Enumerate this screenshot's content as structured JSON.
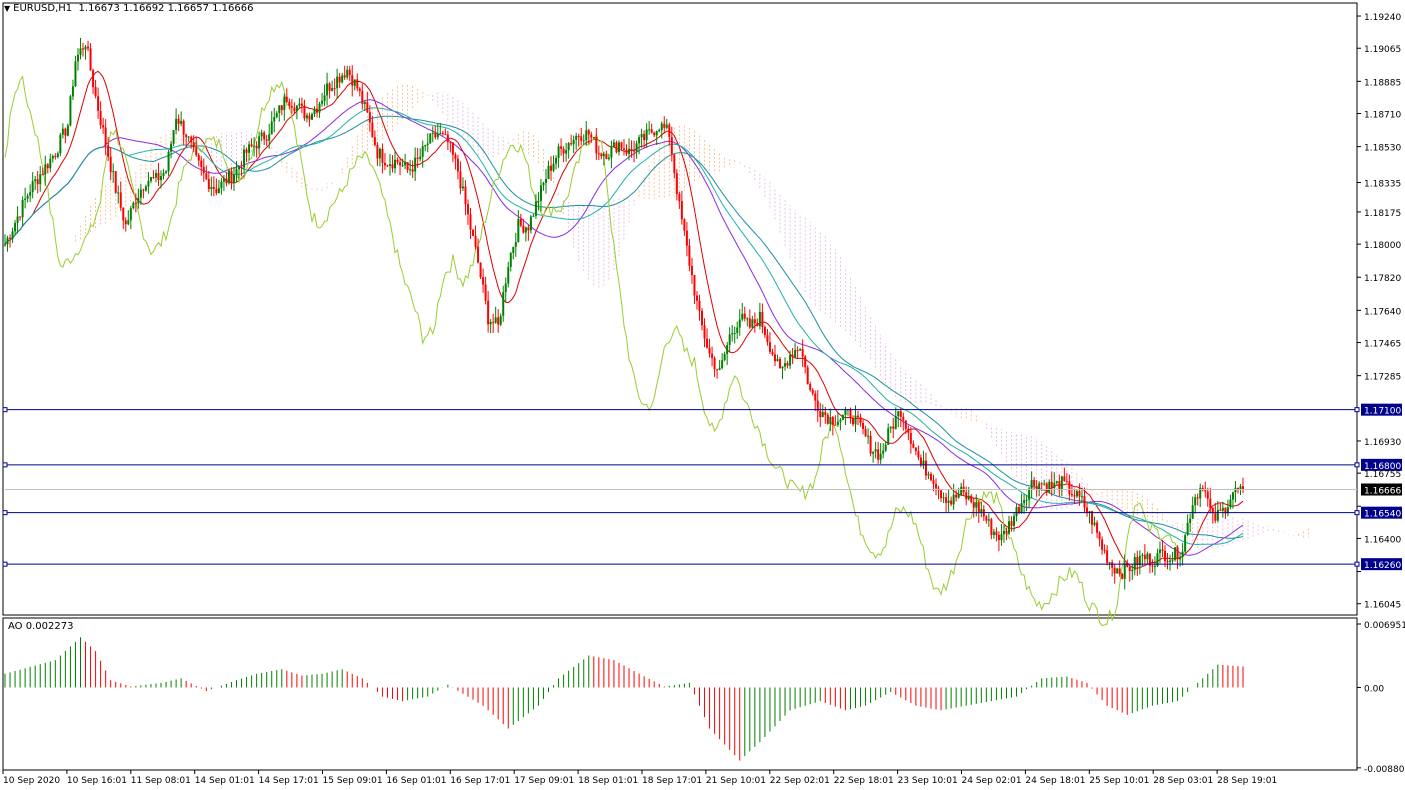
{
  "symbol_header": {
    "menu_icon": "triangle-down-icon",
    "symbol": "EURUSD,H1",
    "ohlc": "1.16673 1.16692 1.16657 1.16666"
  },
  "indicator_header": {
    "name": "AO",
    "value": "0.002273"
  },
  "colors": {
    "bull": "#008000",
    "bear": "#ff0000",
    "ma_red": "#e00000",
    "ma_purple": "#8a2be2",
    "ma_teal": "#20b2aa",
    "ma_blue_green": "#1e90a0",
    "chikou": "#9acd32",
    "kumo_up": "#f4a460",
    "kumo_down": "#dda0dd",
    "hline": "#00008b",
    "price_label_bg": "#00008b",
    "bid_label_bg": "#000000"
  },
  "chart_data": [
    {
      "type": "candlestick",
      "title": "EURUSD,H1",
      "ylim": [
        1.16,
        1.193
      ],
      "y_ticks": [
        "1.19240",
        "1.19065",
        "1.18885",
        "1.18710",
        "1.18530",
        "1.18335",
        "1.18175",
        "1.18000",
        "1.17820",
        "1.17640",
        "1.17465",
        "1.17285",
        "1.16930",
        "1.16755",
        "1.16575",
        "1.16400",
        "1.16220",
        "1.16045"
      ],
      "x_ticks": [
        "10 Sep 2020",
        "10 Sep 16:01",
        "11 Sep 08:01",
        "14 Sep 01:01",
        "14 Sep 17:01",
        "15 Sep 09:01",
        "16 Sep 01:01",
        "16 Sep 17:01",
        "17 Sep 09:01",
        "18 Sep 01:01",
        "18 Sep 17:01",
        "21 Sep 10:01",
        "22 Sep 02:01",
        "22 Sep 18:01",
        "23 Sep 10:01",
        "24 Sep 02:01",
        "24 Sep 18:01",
        "25 Sep 10:01",
        "28 Sep 03:01",
        "28 Sep 19:01"
      ],
      "horizontal_levels": [
        {
          "label": "1.17100",
          "value": 1.171
        },
        {
          "label": "1.16800",
          "value": 1.168
        },
        {
          "label": "1.16540",
          "value": 1.1654
        },
        {
          "label": "1.16260",
          "value": 1.1626
        }
      ],
      "bid": {
        "label": "1.16666",
        "value": 1.16666
      },
      "close_path": [
        [
          0,
          1.18
        ],
        [
          5,
          1.1815
        ],
        [
          10,
          1.183
        ],
        [
          15,
          1.184
        ],
        [
          20,
          1.185
        ],
        [
          25,
          1.1865
        ],
        [
          28,
          1.19
        ],
        [
          32,
          1.191
        ],
        [
          36,
          1.188
        ],
        [
          40,
          1.1855
        ],
        [
          44,
          1.183
        ],
        [
          48,
          1.181
        ],
        [
          52,
          1.1825
        ],
        [
          56,
          1.1835
        ],
        [
          60,
          1.1835
        ],
        [
          64,
          1.184
        ],
        [
          68,
          1.187
        ],
        [
          72,
          1.186
        ],
        [
          76,
          1.1845
        ],
        [
          80,
          1.1835
        ],
        [
          84,
          1.183
        ],
        [
          88,
          1.1835
        ],
        [
          92,
          1.184
        ],
        [
          96,
          1.185
        ],
        [
          100,
          1.1855
        ],
        [
          104,
          1.186
        ],
        [
          108,
          1.187
        ],
        [
          112,
          1.188
        ],
        [
          116,
          1.1875
        ],
        [
          120,
          1.187
        ],
        [
          124,
          1.1875
        ],
        [
          128,
          1.1885
        ],
        [
          132,
          1.189
        ],
        [
          136,
          1.1895
        ],
        [
          140,
          1.1885
        ],
        [
          144,
          1.187
        ],
        [
          148,
          1.185
        ],
        [
          152,
          1.1845
        ],
        [
          156,
          1.1845
        ],
        [
          160,
          1.184
        ],
        [
          164,
          1.1845
        ],
        [
          168,
          1.1855
        ],
        [
          172,
          1.186
        ],
        [
          176,
          1.1855
        ],
        [
          180,
          1.184
        ],
        [
          184,
          1.1815
        ],
        [
          188,
          1.179
        ],
        [
          192,
          1.176
        ],
        [
          196,
          1.1755
        ],
        [
          200,
          1.179
        ],
        [
          204,
          1.181
        ],
        [
          208,
          1.181
        ],
        [
          212,
          1.1825
        ],
        [
          216,
          1.184
        ],
        [
          220,
          1.185
        ],
        [
          224,
          1.1855
        ],
        [
          228,
          1.186
        ],
        [
          232,
          1.186
        ],
        [
          236,
          1.185
        ],
        [
          240,
          1.185
        ],
        [
          244,
          1.1855
        ],
        [
          248,
          1.185
        ],
        [
          252,
          1.1855
        ],
        [
          256,
          1.186
        ],
        [
          260,
          1.1865
        ],
        [
          264,
          1.186
        ],
        [
          268,
          1.182
        ],
        [
          272,
          1.179
        ],
        [
          276,
          1.176
        ],
        [
          280,
          1.174
        ],
        [
          284,
          1.173
        ],
        [
          288,
          1.175
        ],
        [
          292,
          1.176
        ],
        [
          296,
          1.1755
        ],
        [
          300,
          1.176
        ],
        [
          304,
          1.1745
        ],
        [
          308,
          1.173
        ],
        [
          312,
          1.174
        ],
        [
          316,
          1.1745
        ],
        [
          320,
          1.172
        ],
        [
          324,
          1.171
        ],
        [
          328,
          1.1705
        ],
        [
          332,
          1.1705
        ],
        [
          336,
          1.1708
        ],
        [
          340,
          1.17
        ],
        [
          344,
          1.169
        ],
        [
          348,
          1.1685
        ],
        [
          352,
          1.17
        ],
        [
          356,
          1.171
        ],
        [
          360,
          1.1695
        ],
        [
          364,
          1.168
        ],
        [
          368,
          1.1675
        ],
        [
          372,
          1.1665
        ],
        [
          376,
          1.166
        ],
        [
          380,
          1.1665
        ],
        [
          384,
          1.166
        ],
        [
          388,
          1.1655
        ],
        [
          392,
          1.1645
        ],
        [
          396,
          1.164
        ],
        [
          400,
          1.165
        ],
        [
          404,
          1.166
        ],
        [
          408,
          1.167
        ],
        [
          412,
          1.167
        ],
        [
          416,
          1.1668
        ],
        [
          420,
          1.167
        ],
        [
          424,
          1.1665
        ],
        [
          428,
          1.166
        ],
        [
          432,
          1.165
        ],
        [
          436,
          1.1635
        ],
        [
          440,
          1.1625
        ],
        [
          444,
          1.1622
        ],
        [
          448,
          1.1625
        ],
        [
          452,
          1.163
        ],
        [
          456,
          1.1628
        ],
        [
          460,
          1.1632
        ],
        [
          464,
          1.163
        ],
        [
          468,
          1.1635
        ],
        [
          472,
          1.166
        ],
        [
          476,
          1.167
        ],
        [
          480,
          1.165
        ],
        [
          484,
          1.1655
        ],
        [
          488,
          1.1665
        ],
        [
          492,
          1.16666
        ]
      ],
      "ao_series": {
        "name": "AO",
        "ylim": [
          -0.00882,
          0.00695
        ],
        "y_ticks": [
          "0.006951",
          "0.00",
          "-0.008802"
        ],
        "envelope": [
          [
            0,
            0.0015
          ],
          [
            20,
            0.003
          ],
          [
            30,
            0.0055
          ],
          [
            36,
            0.004
          ],
          [
            42,
            0.0008
          ],
          [
            50,
            0.0001
          ],
          [
            62,
            0.0005
          ],
          [
            70,
            0.001
          ],
          [
            80,
            -0.0004
          ],
          [
            92,
            0.0008
          ],
          [
            100,
            0.0015
          ],
          [
            110,
            0.002
          ],
          [
            118,
            0.0013
          ],
          [
            126,
            0.0015
          ],
          [
            134,
            0.002
          ],
          [
            142,
            0.001
          ],
          [
            150,
            -0.001
          ],
          [
            158,
            -0.0015
          ],
          [
            168,
            -0.001
          ],
          [
            176,
            0.0003
          ],
          [
            190,
            -0.002
          ],
          [
            200,
            -0.0045
          ],
          [
            212,
            -0.002
          ],
          [
            220,
            0.001
          ],
          [
            232,
            0.0035
          ],
          [
            242,
            0.003
          ],
          [
            252,
            0.0015
          ],
          [
            262,
            0.0001
          ],
          [
            272,
            0.0005
          ],
          [
            280,
            -0.0045
          ],
          [
            292,
            -0.008
          ],
          [
            300,
            -0.006
          ],
          [
            312,
            -0.0025
          ],
          [
            324,
            -0.0015
          ],
          [
            334,
            -0.0025
          ],
          [
            342,
            -0.002
          ],
          [
            352,
            -0.0005
          ],
          [
            362,
            -0.002
          ],
          [
            372,
            -0.0025
          ],
          [
            382,
            -0.002
          ],
          [
            392,
            -0.0015
          ],
          [
            402,
            -0.001
          ],
          [
            412,
            0.001
          ],
          [
            422,
            0.0012
          ],
          [
            430,
            0.0005
          ],
          [
            438,
            -0.002
          ],
          [
            446,
            -0.003
          ],
          [
            456,
            -0.002
          ],
          [
            466,
            -0.0015
          ],
          [
            474,
            0.0005
          ],
          [
            482,
            0.0025
          ],
          [
            492,
            0.0023
          ]
        ]
      }
    }
  ]
}
